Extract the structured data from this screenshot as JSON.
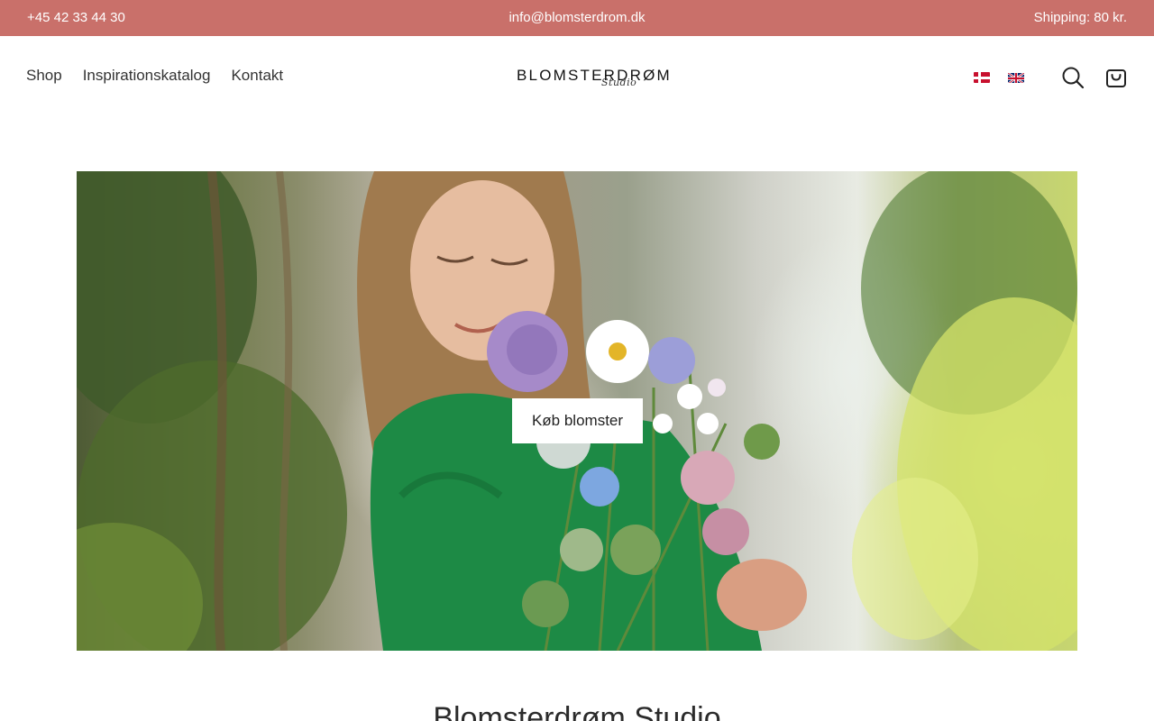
{
  "topbar": {
    "phone": "+45 42 33 44 30",
    "email": "info@blomsterdrom.dk",
    "shipping": "Shipping: 80 kr.",
    "bg_color": "#c9706a"
  },
  "nav": {
    "items": [
      {
        "label": "Shop"
      },
      {
        "label": "Inspirationskatalog"
      },
      {
        "label": "Kontakt"
      }
    ]
  },
  "logo": {
    "word": "BLOMSTERDRØM",
    "script": "Studio"
  },
  "header": {
    "languages": [
      "da-flag-icon",
      "en-flag-icon"
    ],
    "icons": [
      "search-icon",
      "cart-icon"
    ]
  },
  "hero": {
    "cta_label": "Køb blomster",
    "image": "woman-with-flower-bouquet"
  },
  "section": {
    "title": "Blomsterdrøm Studio"
  }
}
